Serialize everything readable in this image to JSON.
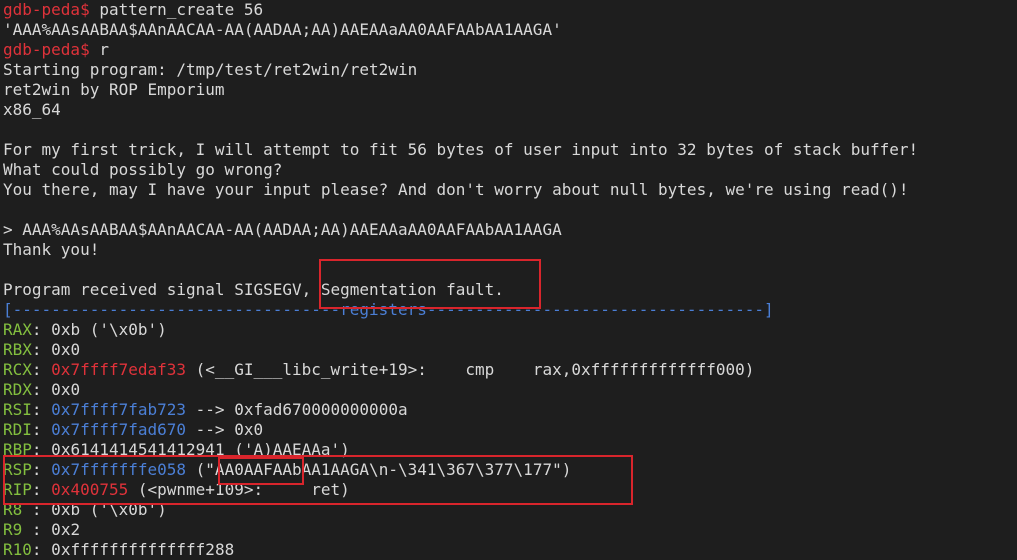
{
  "prompt": "gdb-peda$",
  "session": {
    "cmd1": "pattern_create 56",
    "pattern_output": "'AAA%AAsAABAA$AAnAACAA-AA(AADAA;AA)AAEAAaAA0AAFAAbAA1AAGA'",
    "cmd2": "r",
    "starting": "Starting program: /tmp/test/ret2win/ret2win",
    "banner1": "ret2win by ROP Emporium",
    "banner2": "x86_64",
    "intro1": "For my first trick, I will attempt to fit 56 bytes of user input into 32 bytes of stack buffer!",
    "intro2": "What could possibly go wrong?",
    "intro3": "You there, may I have your input please? And don't worry about null bytes, we're using read()!",
    "input_line": "> AAA%AAsAABAA$AAnAACAA-AA(AADAA;AA)AAEAAaAA0AAFAAbAA1AAGA",
    "thanks": "Thank you!",
    "signal_prefix": "Program received signal SIGSEGV, ",
    "signal_msg": "Segmentation fault.",
    "section_header": "[----------------------------------registers-----------------------------------]"
  },
  "registers": {
    "rax": {
      "name": "RAX",
      "value": " 0xb ('\\x0b')"
    },
    "rbx": {
      "name": "RBX",
      "value": " 0x0"
    },
    "rcx": {
      "name": "RCX",
      "addr": "0x7ffff7edaf33",
      "value": " (<__GI___libc_write+19>:    cmp    rax,0xfffffffffffff000)"
    },
    "rdx": {
      "name": "RDX",
      "value": " 0x0"
    },
    "rsi": {
      "name": "RSI",
      "addr": "0x7ffff7fab723",
      "value": " --> 0xfad670000000000a"
    },
    "rdi": {
      "name": "RDI",
      "addr": "0x7ffff7fad670",
      "value": " --> 0x0"
    },
    "rbp": {
      "name": "RBP",
      "value": " 0x6141414541412941 ('A)AAEAAa')"
    },
    "rsp": {
      "name": "RSP",
      "addr": "0x7fffffffe058",
      "value": " (\"AA0AAFAAbAA1AAGA\\n-\\341\\367\\377\\177\")"
    },
    "rip": {
      "name": "RIP",
      "addr": "0x400755",
      "value": " (<pwnme+109>:     ret)"
    },
    "r8": {
      "name": "R8 ",
      "value": " 0xb ('\\x0b')"
    },
    "r9": {
      "name": "R9 ",
      "value": " 0x2"
    },
    "r10": {
      "name": "R10",
      "value": " 0xffffffffffffff288"
    }
  }
}
